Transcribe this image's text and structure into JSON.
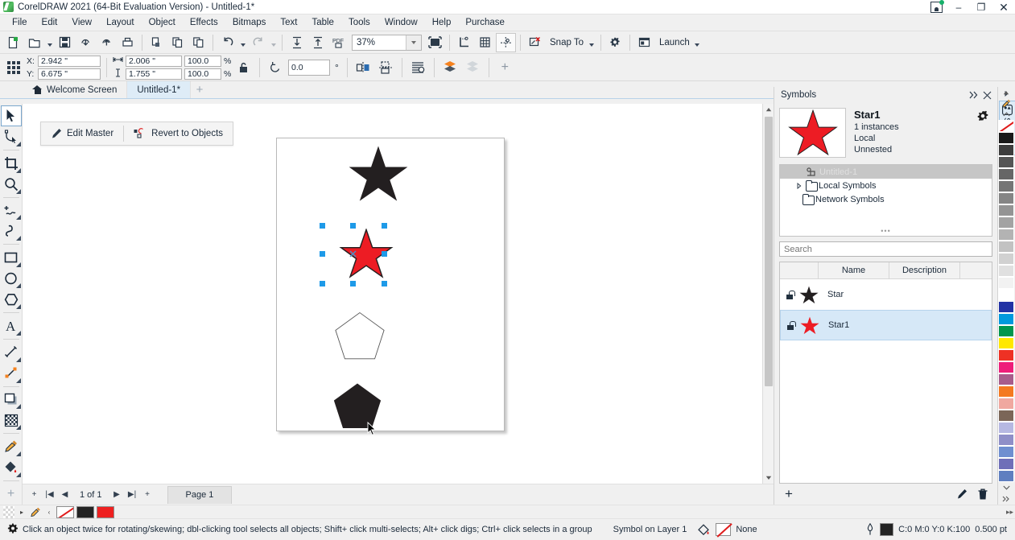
{
  "window": {
    "title": "CorelDRAW 2021 (64-Bit Evaluation Version) - Untitled-1*",
    "minimize": "–",
    "restore": "❐",
    "close": "✕"
  },
  "menubar": {
    "items": [
      "File",
      "Edit",
      "View",
      "Layout",
      "Object",
      "Effects",
      "Bitmaps",
      "Text",
      "Table",
      "Tools",
      "Window",
      "Help",
      "Purchase"
    ]
  },
  "toolbar": {
    "zoom_level": "37%",
    "snap_to_label": "Snap To",
    "launch_label": "Launch",
    "icons": [
      "new-document-icon",
      "open-document-icon",
      "save-icon",
      "import-icon",
      "export-icon",
      "print-icon",
      "publish-to-pdf-icon",
      "copy-icon",
      "paste-icon",
      "undo-icon",
      "redo-icon",
      "import-arrow-icon",
      "export-arrow-icon",
      "pdf-icon",
      "zoom-level-input",
      "full-screen-preview-icon",
      "show-rulers-icon",
      "show-grid-icon",
      "show-guides-icon",
      "snap-to-icon",
      "options-gear-icon",
      "launch-icon"
    ]
  },
  "property_bar": {
    "x_label": "X:",
    "x_value": "2.942 \"",
    "y_label": "Y:",
    "y_value": "6.675 \"",
    "width_value": "2.006 \"",
    "height_value": "1.755 \"",
    "scale_h": "100.0",
    "scale_v": "100.0",
    "percent": "%",
    "rotation": "0.0",
    "degree_symbol": "°",
    "lock_ratio_icon": "lock-ratio-icon",
    "mirror_h_icon": "mirror-horizontal-icon",
    "mirror_v_icon": "mirror-vertical-icon",
    "text_wrap_icon": "wrap-paragraph-text-icon",
    "to_front_icon": "to-front-of-layer-icon",
    "to_back_icon": "to-back-of-layer-icon",
    "add_icon": "+"
  },
  "tabs": {
    "items": [
      {
        "label": "Welcome Screen",
        "icon": "home-icon",
        "active": false
      },
      {
        "label": "Untitled-1*",
        "icon": "",
        "active": true
      }
    ],
    "add_label": "+"
  },
  "toolbox": {
    "tools": [
      {
        "name": "pick-tool",
        "selected": true
      },
      {
        "name": "shape-tool",
        "selected": false
      },
      {
        "name": "crop-tool",
        "selected": false
      },
      {
        "name": "zoom-tool",
        "selected": false
      },
      {
        "name": "freehand-tool",
        "selected": false
      },
      {
        "name": "artistic-media-tool",
        "selected": false
      },
      {
        "name": "rectangle-tool",
        "selected": false
      },
      {
        "name": "ellipse-tool",
        "selected": false
      },
      {
        "name": "polygon-tool",
        "selected": false
      },
      {
        "name": "text-tool",
        "selected": false
      },
      {
        "name": "parallel-dimension-tool",
        "selected": false
      },
      {
        "name": "straight-line-connector-tool",
        "selected": false
      },
      {
        "name": "drop-shadow-tool",
        "selected": false
      },
      {
        "name": "transparency-tool",
        "selected": false
      },
      {
        "name": "color-eyedropper-tool",
        "selected": false
      },
      {
        "name": "interactive-fill-tool",
        "selected": false
      },
      {
        "name": "add-tool",
        "selected": false
      }
    ]
  },
  "context_toolbar": {
    "edit_master_label": "Edit Master",
    "revert_label": "Revert to Objects"
  },
  "canvas": {
    "shapes": [
      {
        "name": "black-star",
        "type": "star",
        "fill": "#231f20",
        "selected": false
      },
      {
        "name": "red-star-symbol-instance",
        "type": "star",
        "fill": "#ed1c24",
        "selected": true
      },
      {
        "name": "white-pentagon",
        "type": "pentagon",
        "fill": "#ffffff",
        "selected": false
      },
      {
        "name": "black-pentagon",
        "type": "pentagon",
        "fill": "#231f20",
        "selected": false
      }
    ],
    "selection_handle_color": "#1e9ae8"
  },
  "page_nav": {
    "page_count": "1 of 1",
    "page_tab": "Page 1",
    "first": "|◀",
    "prev": "◀",
    "next": "▶",
    "last": "▶|",
    "add_before": "+",
    "add_after": "+"
  },
  "docker": {
    "title": "Symbols",
    "collapse_icon": "collapse-docker-icon",
    "close_icon": "close-docker-icon",
    "symbol": {
      "name": "Star1",
      "instances": "1 instances",
      "scope": "Local",
      "nesting": "Unnested",
      "thumb_color": "#ed1c24",
      "options_icon": "gear-icon"
    },
    "tree": [
      {
        "label": "Untitled-1",
        "icon": "document-symbol-icon",
        "selected": true,
        "expandable": false
      },
      {
        "label": "Local Symbols",
        "icon": "folder-icon",
        "selected": false,
        "expandable": true
      },
      {
        "label": "Network Symbols",
        "icon": "folder-icon",
        "selected": false,
        "expandable": false
      }
    ],
    "search": {
      "placeholder": "Search",
      "value": ""
    },
    "list_headers": [
      "",
      "Name",
      "Description",
      ""
    ],
    "list_rows": [
      {
        "name": "Star",
        "description": "",
        "color": "#231f20",
        "selected": false
      },
      {
        "name": "Star1",
        "description": "",
        "color": "#ed1c24",
        "selected": true
      }
    ],
    "footer": {
      "add_icon": "add-symbol-icon",
      "edit_icon": "edit-symbol-icon",
      "delete_icon": "delete-symbol-icon"
    },
    "rail_tab_label": "Symbols"
  },
  "palette": {
    "colors": [
      "#ffffff",
      "#1a1a1a",
      "#3d3d3d",
      "#555555",
      "#666666",
      "#757575",
      "#858585",
      "#949494",
      "#a3a3a3",
      "#b3b3b3",
      "#c2c2c2",
      "#d1d1d1",
      "#e0e0e0",
      "#f2f2f2",
      "#ffffff",
      "#2233a5",
      "#0099dd",
      "#00964e",
      "#ffe800",
      "#ee3124",
      "#ee1e7a",
      "#a85c8b",
      "#f47920",
      "#f0a8a0",
      "#7b6658",
      "#b6b8e2",
      "#8f8fc8",
      "#6f8fd0",
      "#6f6fb8",
      "#5f7fc0"
    ],
    "none_swatch": "none-color-swatch"
  },
  "color_bar": {
    "none": "#ffffff",
    "black": "#232323",
    "red": "#ee2020",
    "eyedropper_icon": "eyedropper-icon"
  },
  "status_bar": {
    "hint": "Click an object twice for rotating/skewing; dbl-clicking tool selects all objects; Shift+ click multi-selects; Alt+ click digs; Ctrl+ click selects in a group",
    "object_info": "Symbol on Layer 1",
    "fill_label": "None",
    "outline_color": "C:0 M:0 Y:0 K:100",
    "outline_width": "0.500 pt",
    "settings_icon": "status-settings-icon"
  }
}
